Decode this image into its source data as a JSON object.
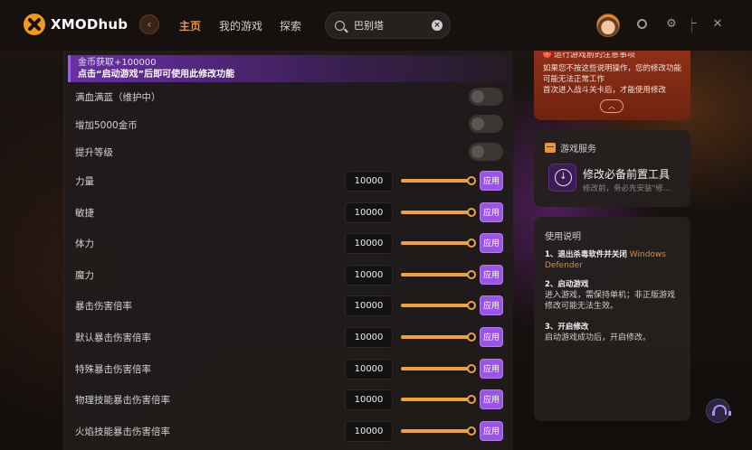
{
  "app": {
    "brand": "XMODhub",
    "nav": {
      "home": "主页",
      "my_games": "我的游戏",
      "explore": "探索"
    },
    "search": {
      "value": "巴别塔",
      "placeholder": ""
    },
    "icons": {
      "back": "back-arrow-icon",
      "search": "search-icon",
      "clear": "clear-icon",
      "support": "headset-icon"
    },
    "accent": "#f2913a",
    "purple": "#9b55e6"
  },
  "banner": {
    "line1": "金币获取+100000",
    "line2": "点击“启动游戏”后即可使用此修改功能"
  },
  "toggles": [
    {
      "label": "满血满蓝（维护中）",
      "on": false
    },
    {
      "label": "增加5000金币",
      "on": false
    },
    {
      "label": "提升等级",
      "on": false
    }
  ],
  "stats": [
    {
      "label": "力量",
      "value": "10000",
      "slider_fraction": 1.0,
      "button": "应用"
    },
    {
      "label": "敏捷",
      "value": "10000",
      "slider_fraction": 1.0,
      "button": "应用"
    },
    {
      "label": "体力",
      "value": "10000",
      "slider_fraction": 1.0,
      "button": "应用"
    },
    {
      "label": "魔力",
      "value": "10000",
      "slider_fraction": 1.0,
      "button": "应用"
    },
    {
      "label": "暴击伤害倍率",
      "value": "10000",
      "slider_fraction": 1.0,
      "button": "应用"
    },
    {
      "label": "默认暴击伤害倍率",
      "value": "10000",
      "slider_fraction": 1.0,
      "button": "应用"
    },
    {
      "label": "特殊暴击伤害倍率",
      "value": "10000",
      "slider_fraction": 1.0,
      "button": "应用"
    },
    {
      "label": "物理技能暴击伤害倍率",
      "value": "10000",
      "slider_fraction": 1.0,
      "button": "应用"
    },
    {
      "label": "火焰技能暴击伤害倍率",
      "value": "10000",
      "slider_fraction": 1.0,
      "button": "应用"
    }
  ],
  "notice": {
    "title": "运行游戏前的注意事项",
    "text": "如果您不按这些说明操作，您的修改功能可能无法正常工作\n首次进入战斗关卡后，才能使用修改",
    "more": "︿"
  },
  "service": {
    "heading": "游戏服务",
    "tool_title": "修改必备前置工具",
    "tool_sub": "修改前，务必先安装\"修..."
  },
  "guide": {
    "heading": "使用说明",
    "step1_title": "1、退出杀毒软件并关闭",
    "step1_link": "Windows Defender",
    "step2_title": "2、启动游戏",
    "step2_body": "进入游戏，需保持单机；非正版游戏修改可能无法生效。",
    "step3_title": "3、开启修改",
    "step3_body": "启动游戏成功后，开启修改。"
  }
}
